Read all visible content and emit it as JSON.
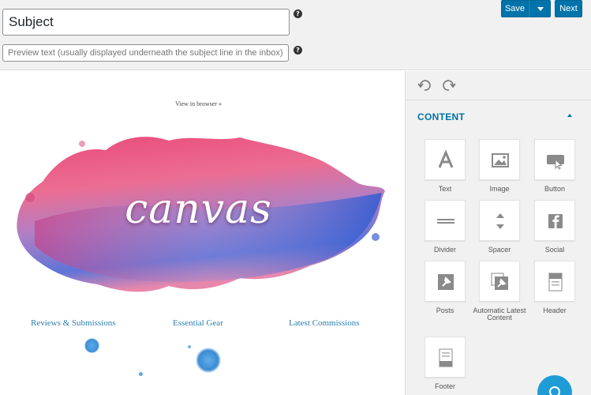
{
  "header": {
    "subject_value": "Subject",
    "preview_placeholder": "Preview text (usually displayed underneath the subject line in the inbox)",
    "save_label": "Save",
    "next_label": "Next"
  },
  "email": {
    "view_in_browser": "View in browser »",
    "hero_title": "canvas",
    "links": [
      "Reviews & Submissions",
      "Essential Gear",
      "Latest Commissions"
    ]
  },
  "sidebar": {
    "content_heading": "CONTENT",
    "blocks": [
      {
        "label": "Text",
        "icon": "text-icon"
      },
      {
        "label": "Image",
        "icon": "image-icon"
      },
      {
        "label": "Button",
        "icon": "button-icon"
      },
      {
        "label": "Divider",
        "icon": "divider-icon"
      },
      {
        "label": "Spacer",
        "icon": "spacer-icon"
      },
      {
        "label": "Social",
        "icon": "facebook-icon"
      },
      {
        "label": "Posts",
        "icon": "posts-icon"
      },
      {
        "label": "Automatic Latest Content",
        "icon": "automatic-latest-content-icon"
      },
      {
        "label": "Header",
        "icon": "header-icon"
      },
      {
        "label": "Footer",
        "icon": "footer-icon"
      }
    ]
  },
  "colors": {
    "accent": "#0073aa",
    "link": "#2d7fae",
    "sidebar_bg": "#f1f1f1",
    "fab": "#1f9bd6"
  }
}
